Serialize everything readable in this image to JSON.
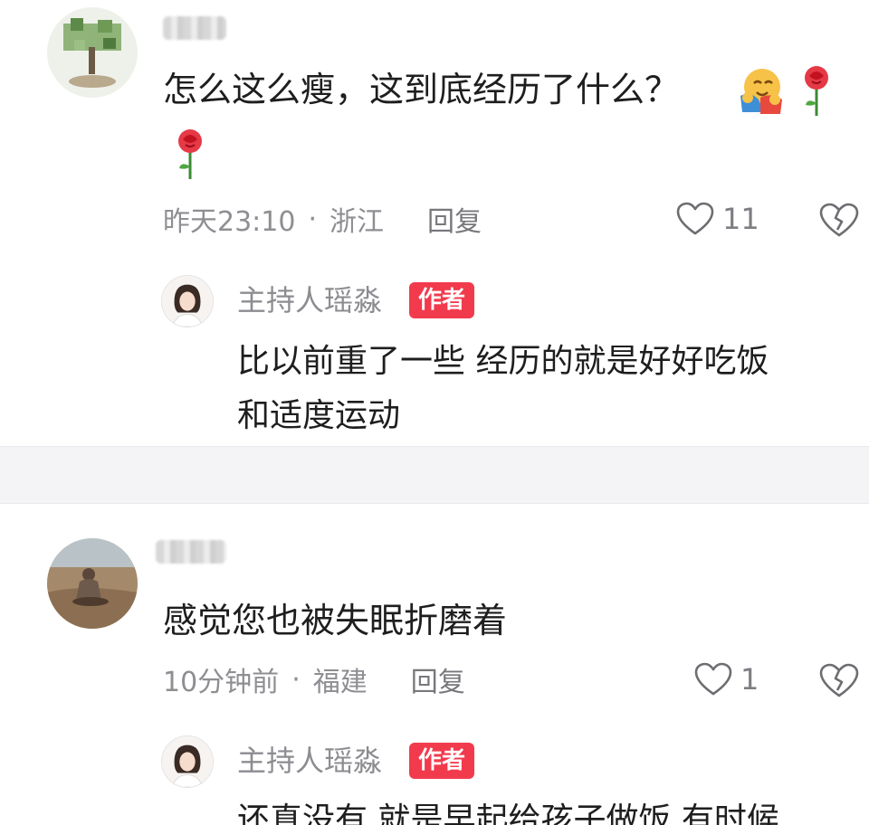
{
  "comments": [
    {
      "text_line1": "怎么这么瘦，这到底经历了什么？",
      "time": "昨天23:10",
      "location": "浙江",
      "reply_label": "回复",
      "likes": "11",
      "author_reply": {
        "name": "主持人瑶淼",
        "badge": "作者",
        "line1": "比以前重了一些 经历的就是好好吃饭",
        "line2": "和适度运动"
      }
    },
    {
      "text_line1": "感觉您也被失眠折磨着",
      "time": "10分钟前",
      "location": "福建",
      "reply_label": "回复",
      "likes": "1",
      "author_reply": {
        "name": "主持人瑶淼",
        "badge": "作者",
        "line1": "还真没有 就是早起给孩子做饭 有时候"
      }
    }
  ],
  "meta_separator": "·",
  "colors": {
    "badge": "#f23a4d",
    "meta_text": "#8e8e93",
    "background": "#f4f4f6"
  }
}
